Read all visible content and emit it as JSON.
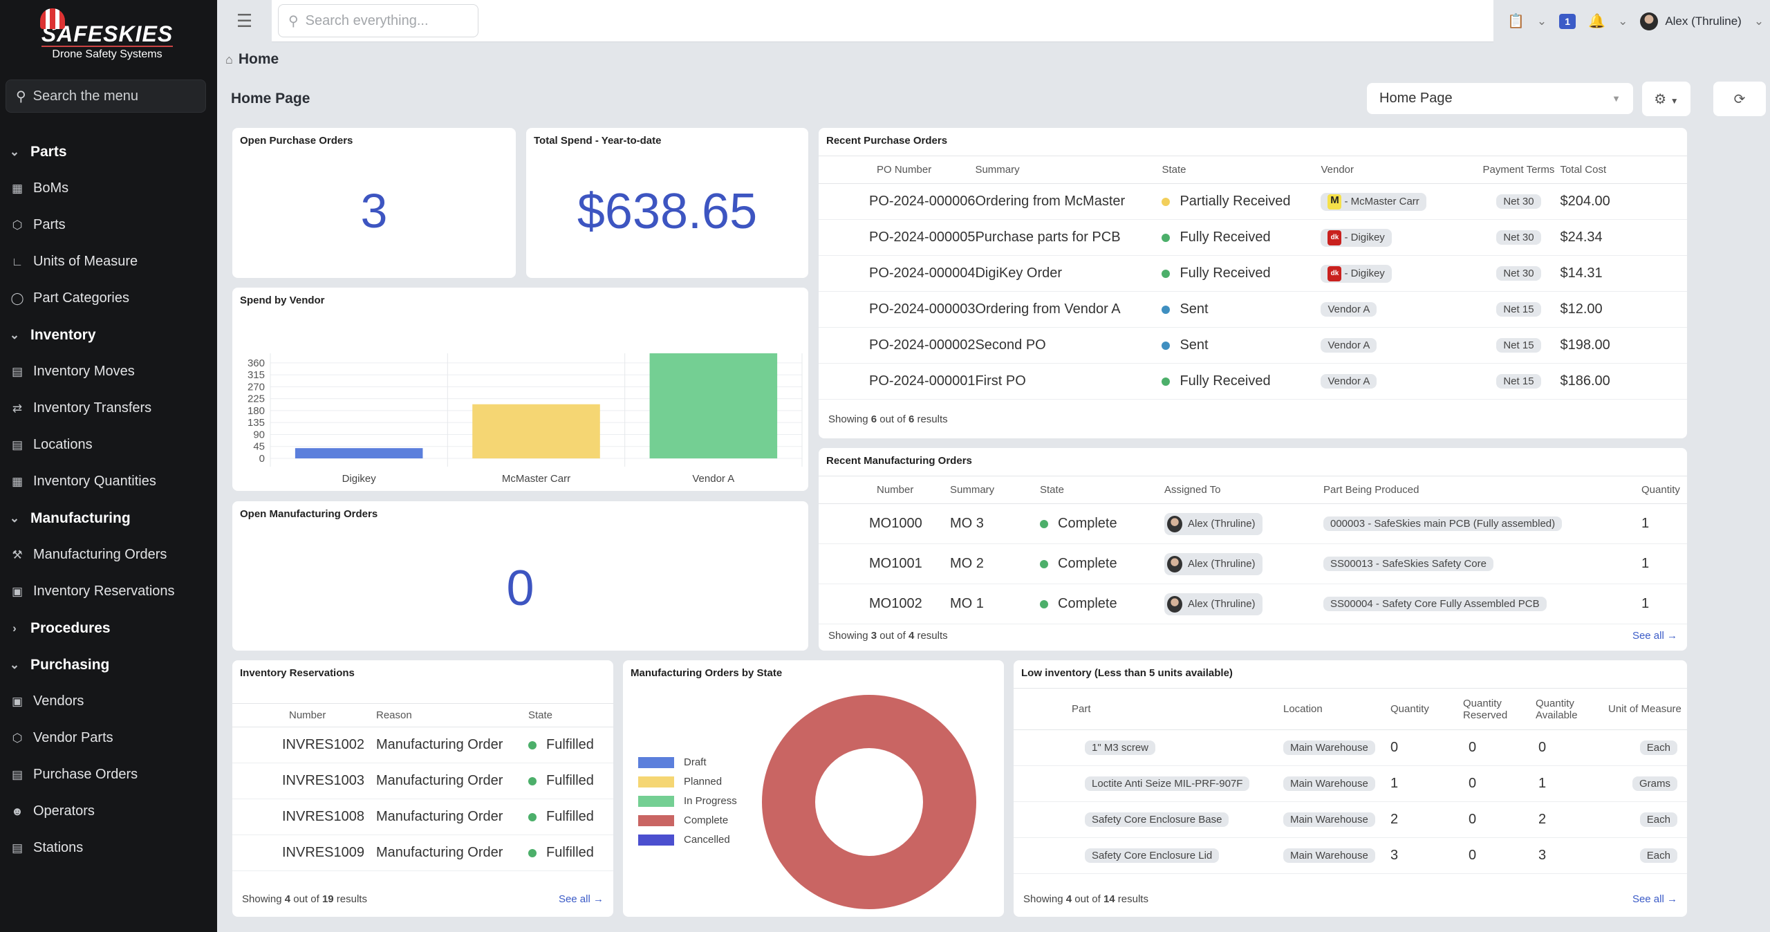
{
  "brand": {
    "name": "SAFESKIES",
    "tagline": "Drone Safety Systems"
  },
  "sidebar": {
    "search_placeholder": "Search the menu",
    "items": [
      {
        "label": "Parts",
        "section": true,
        "icon": "chevron-down-icon"
      },
      {
        "label": "BoMs",
        "icon": "cubes-icon"
      },
      {
        "label": "Parts",
        "icon": "box-icon"
      },
      {
        "label": "Units of Measure",
        "icon": "ruler-icon"
      },
      {
        "label": "Part Categories",
        "icon": "tag-icon"
      },
      {
        "label": "Inventory",
        "section": true,
        "icon": "chevron-down-icon"
      },
      {
        "label": "Inventory Moves",
        "icon": "clipboard-icon"
      },
      {
        "label": "Inventory Transfers",
        "icon": "truck-icon"
      },
      {
        "label": "Locations",
        "icon": "warehouse-icon"
      },
      {
        "label": "Inventory Quantities",
        "icon": "boxes-icon"
      },
      {
        "label": "Manufacturing",
        "section": true,
        "icon": "chevron-down-icon"
      },
      {
        "label": "Manufacturing Orders",
        "icon": "wrench-icon"
      },
      {
        "label": "Inventory Reservations",
        "icon": "calendar-icon"
      },
      {
        "label": "Procedures",
        "section": true,
        "icon": "chevron-right-icon"
      },
      {
        "label": "Purchasing",
        "section": true,
        "icon": "chevron-down-icon"
      },
      {
        "label": "Vendors",
        "icon": "vendor-icon"
      },
      {
        "label": "Vendor Parts",
        "icon": "box-icon"
      },
      {
        "label": "Purchase Orders",
        "icon": "receipt-icon"
      },
      {
        "label": "Operators",
        "icon": "user-icon"
      },
      {
        "label": "Stations",
        "icon": "station-icon"
      }
    ]
  },
  "topbar": {
    "search_placeholder": "Search everything...",
    "notification_count": "1",
    "user": "Alex (Thruline)"
  },
  "breadcrumb": "Home",
  "page_title": "Home Page",
  "page_select": "Home Page",
  "open_po": {
    "title": "Open Purchase Orders",
    "value": "3"
  },
  "total_spend": {
    "title": "Total Spend - Year-to-date",
    "value": "$638.65"
  },
  "open_mo": {
    "title": "Open Manufacturing Orders",
    "value": "0"
  },
  "recent_po": {
    "title": "Recent Purchase Orders",
    "columns": [
      "PO Number",
      "Summary",
      "State",
      "Vendor",
      "Payment Terms",
      "Total Cost"
    ],
    "rows": [
      {
        "number": "PO-2024-000006",
        "summary": "Ordering from McMaster",
        "state": "Partially Received",
        "state_color": "#f2cf5b",
        "vendor": "- McMaster Carr",
        "vendor_logo": "M",
        "terms": "Net 30",
        "cost": "$204.00"
      },
      {
        "number": "PO-2024-000005",
        "summary": "Purchase parts for PCB",
        "state": "Fully Received",
        "state_color": "#4caf6a",
        "vendor": "- Digikey",
        "vendor_logo": "D",
        "terms": "Net 30",
        "cost": "$24.34"
      },
      {
        "number": "PO-2024-000004",
        "summary": "DigiKey Order",
        "state": "Fully Received",
        "state_color": "#4caf6a",
        "vendor": "- Digikey",
        "vendor_logo": "D",
        "terms": "Net 30",
        "cost": "$14.31"
      },
      {
        "number": "PO-2024-000003",
        "summary": "Ordering from Vendor A",
        "state": "Sent",
        "state_color": "#3f8fc0",
        "vendor": "Vendor A",
        "vendor_logo": "",
        "terms": "Net 15",
        "cost": "$12.00"
      },
      {
        "number": "PO-2024-000002",
        "summary": "Second PO",
        "state": "Sent",
        "state_color": "#3f8fc0",
        "vendor": "Vendor A",
        "vendor_logo": "",
        "terms": "Net 15",
        "cost": "$198.00"
      },
      {
        "number": "PO-2024-000001",
        "summary": "First PO",
        "state": "Fully Received",
        "state_color": "#4caf6a",
        "vendor": "Vendor A",
        "vendor_logo": "",
        "terms": "Net 15",
        "cost": "$186.00"
      }
    ],
    "footer": {
      "prefix": "Showing",
      "shown": "6",
      "mid": "out of",
      "total": "6",
      "suffix": "results"
    }
  },
  "recent_mo": {
    "title": "Recent Manufacturing Orders",
    "columns": [
      "Number",
      "Summary",
      "State",
      "Assigned To",
      "Part Being Produced",
      "Quantity"
    ],
    "rows": [
      {
        "number": "MO1000",
        "summary": "MO 3",
        "state": "Complete",
        "assigned": "Alex (Thruline)",
        "part": "000003 - SafeSkies main PCB (Fully assembled)",
        "qty": "1"
      },
      {
        "number": "MO1001",
        "summary": "MO 2",
        "state": "Complete",
        "assigned": "Alex (Thruline)",
        "part": "SS00013 - SafeSkies Safety Core",
        "qty": "1"
      },
      {
        "number": "MO1002",
        "summary": "MO 1",
        "state": "Complete",
        "assigned": "Alex (Thruline)",
        "part": "SS00004 - Safety Core Fully Assembled PCB",
        "qty": "1"
      }
    ],
    "footer": {
      "prefix": "Showing",
      "shown": "3",
      "mid": "out of",
      "total": "4",
      "suffix": "results"
    },
    "see_all": "See all"
  },
  "inv_res": {
    "title": "Inventory Reservations",
    "columns": [
      "Number",
      "Reason",
      "State"
    ],
    "rows": [
      {
        "number": "INVRES1002",
        "reason": "Manufacturing Order",
        "state": "Fulfilled"
      },
      {
        "number": "INVRES1003",
        "reason": "Manufacturing Order",
        "state": "Fulfilled"
      },
      {
        "number": "INVRES1008",
        "reason": "Manufacturing Order",
        "state": "Fulfilled"
      },
      {
        "number": "INVRES1009",
        "reason": "Manufacturing Order",
        "state": "Fulfilled"
      }
    ],
    "footer": {
      "prefix": "Showing",
      "shown": "4",
      "mid": "out of",
      "total": "19",
      "suffix": "results"
    },
    "see_all": "See all"
  },
  "low_inv": {
    "title": "Low inventory (Less than 5 units available)",
    "columns": [
      "Part",
      "Location",
      "Quantity",
      "Quantity Reserved",
      "Quantity Available",
      "Unit of Measure"
    ],
    "rows": [
      {
        "part": "1\" M3 screw",
        "location": "Main Warehouse",
        "qty": "0",
        "reserved": "0",
        "available": "0",
        "uom": "Each"
      },
      {
        "part": "Loctite Anti Seize MIL-PRF-907F",
        "location": "Main Warehouse",
        "qty": "1",
        "reserved": "0",
        "available": "1",
        "uom": "Grams"
      },
      {
        "part": "Safety Core Enclosure Base",
        "location": "Main Warehouse",
        "qty": "2",
        "reserved": "0",
        "available": "2",
        "uom": "Each"
      },
      {
        "part": "Safety Core Enclosure Lid",
        "location": "Main Warehouse",
        "qty": "3",
        "reserved": "0",
        "available": "3",
        "uom": "Each"
      }
    ],
    "footer": {
      "prefix": "Showing",
      "shown": "4",
      "mid": "out of",
      "total": "14",
      "suffix": "results"
    },
    "see_all": "See all"
  },
  "chart_data": [
    {
      "type": "bar",
      "title": "Spend by Vendor",
      "categories": [
        "Digikey",
        "McMaster Carr",
        "Vendor A"
      ],
      "values": [
        38.65,
        204,
        396
      ],
      "colors": [
        "#5b7fdc",
        "#f5d673",
        "#74cf93"
      ],
      "yticks": [
        0,
        45,
        90,
        135,
        180,
        225,
        270,
        315,
        360
      ],
      "ylim": [
        0,
        396
      ],
      "grid": true
    },
    {
      "type": "pie",
      "title": "Manufacturing Orders by State",
      "donut": true,
      "labels": [
        "Draft",
        "Planned",
        "In Progress",
        "Complete",
        "Cancelled"
      ],
      "values": [
        0,
        0,
        0,
        3,
        0
      ],
      "colors": [
        "#5b7fdc",
        "#f5d673",
        "#74cf93",
        "#c96563",
        "#4b4fcf"
      ],
      "legend": "left"
    }
  ]
}
